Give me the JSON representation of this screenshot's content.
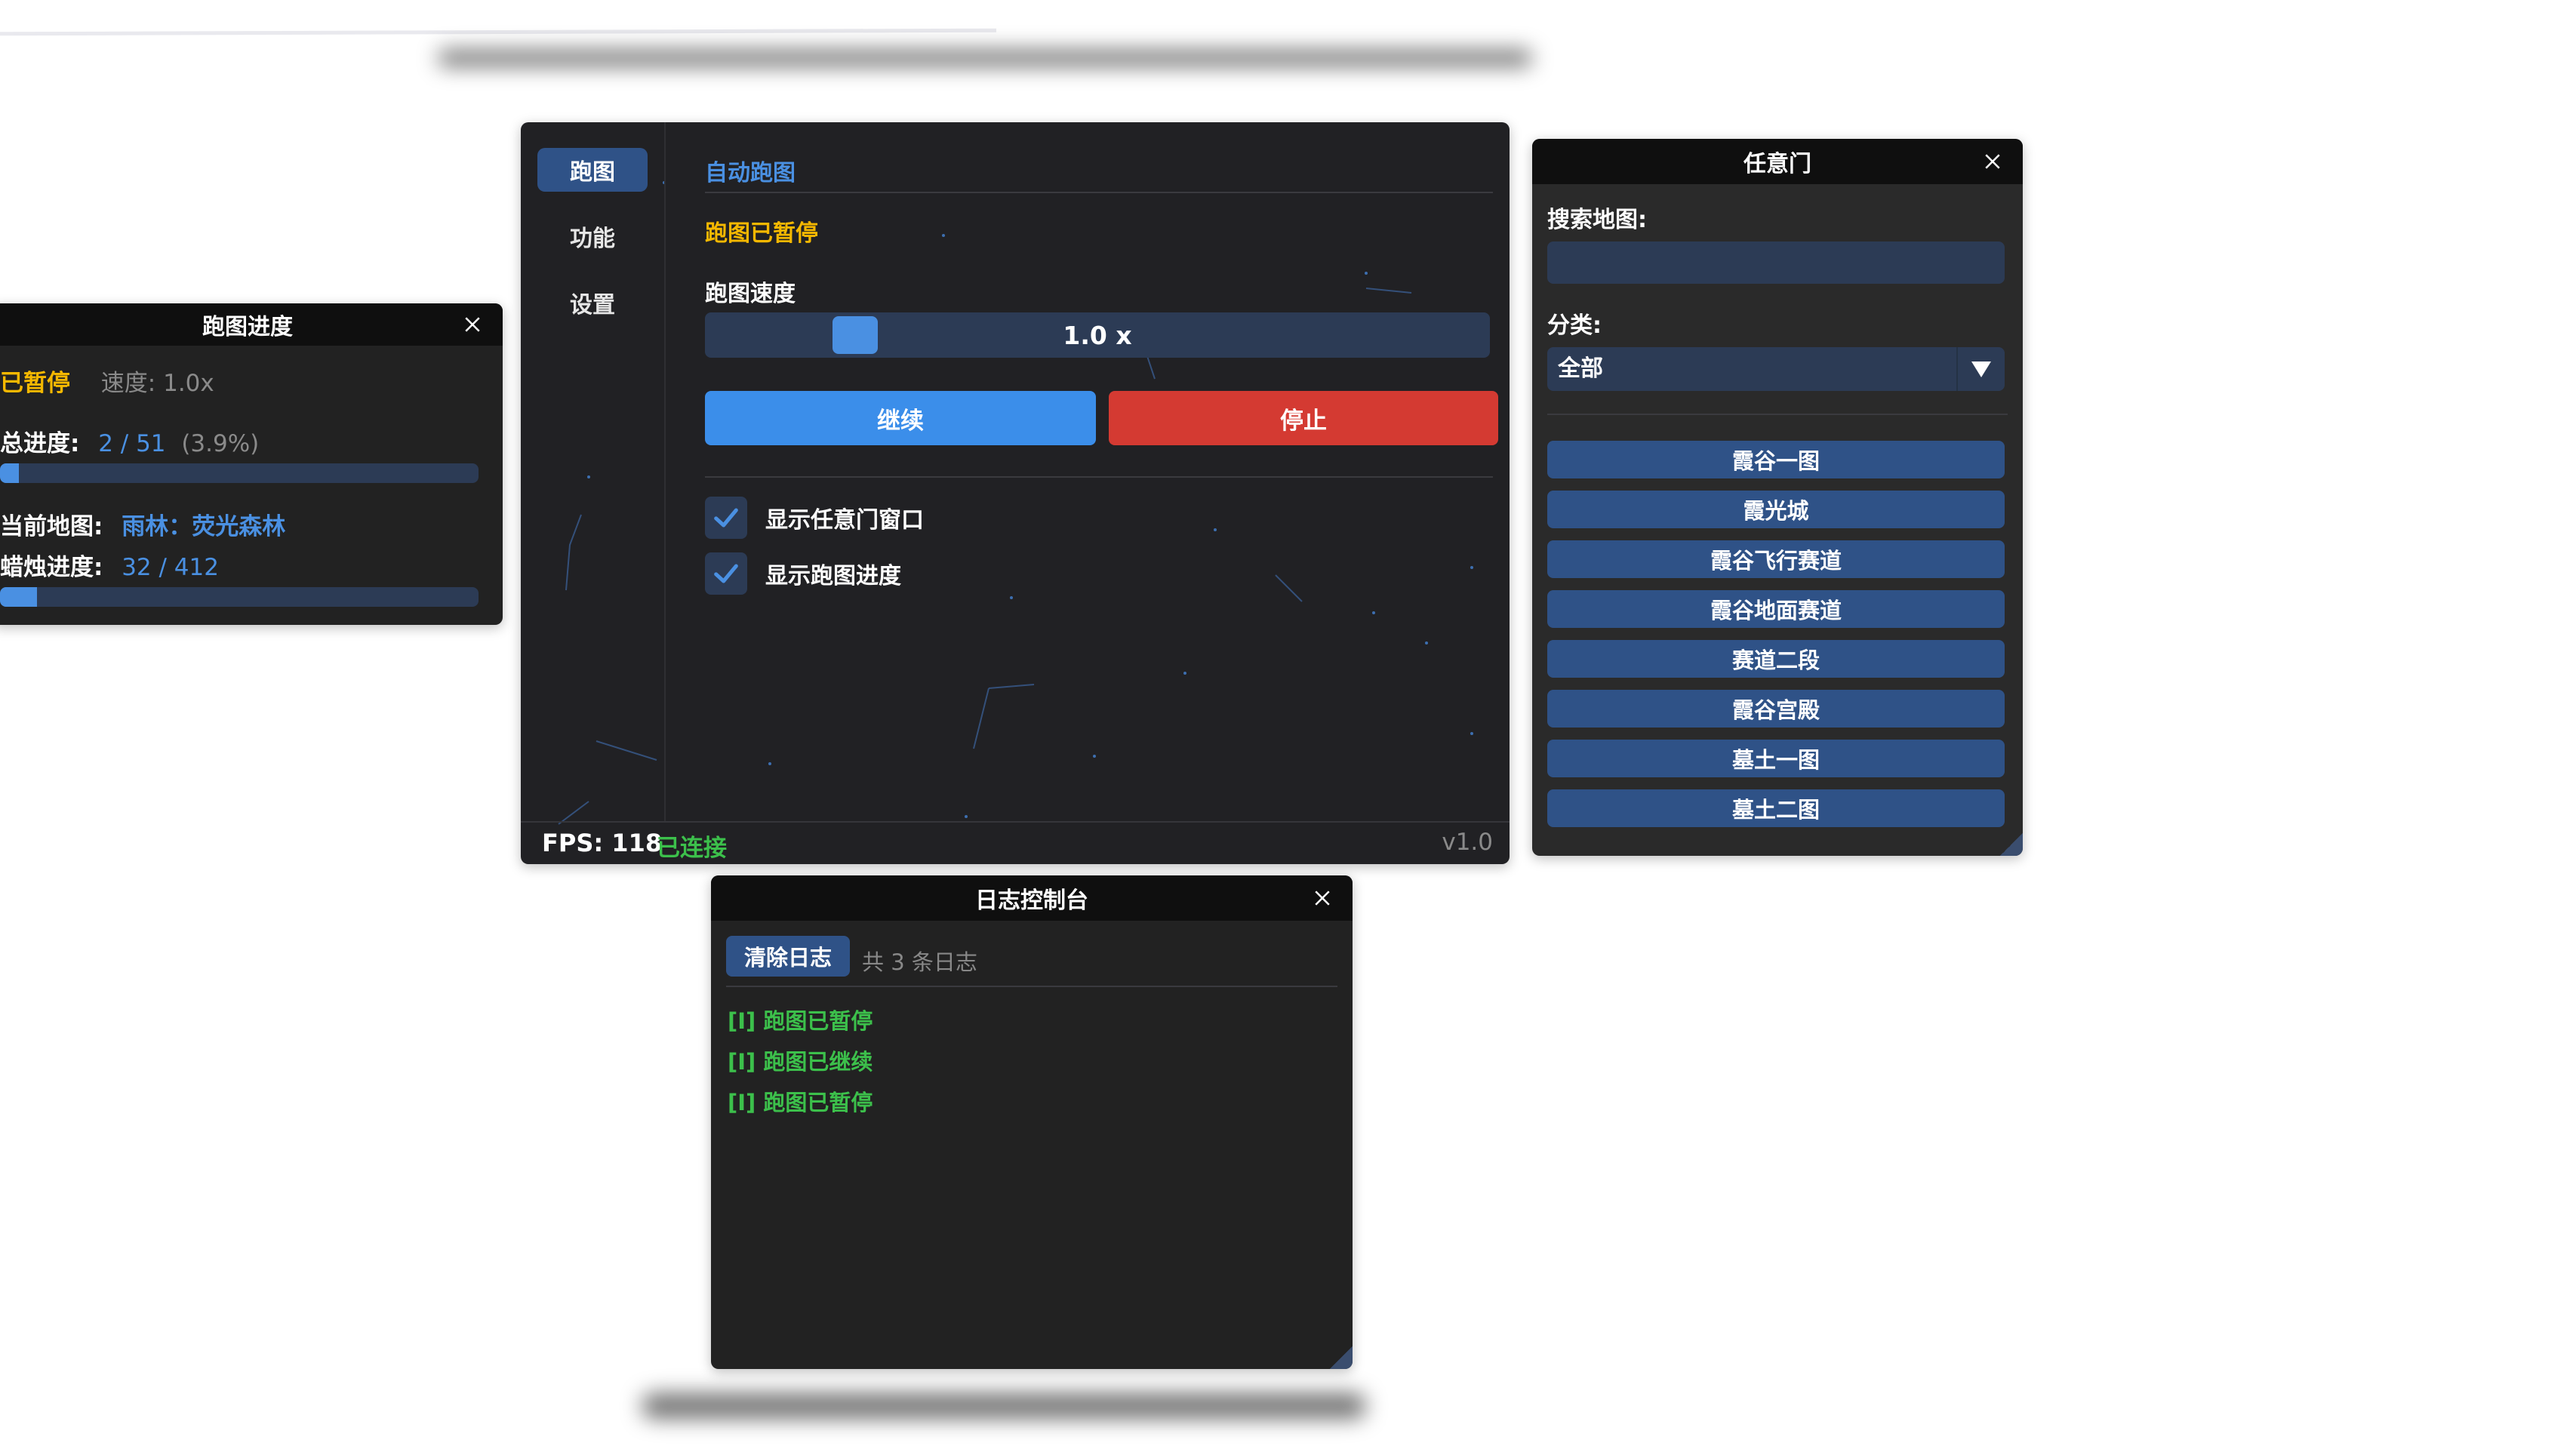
{
  "colors": {
    "accent": "#4a90e2",
    "stop": "#d43a32",
    "paused": "#f5b800",
    "connected": "#3cc04b",
    "panel": "#222222"
  },
  "main": {
    "nav": [
      "跑图",
      "功能",
      "设置"
    ],
    "section_title": "自动跑图",
    "status": "跑图已暂停",
    "speed_label": "跑图速度",
    "speed_value": "1.0 x",
    "speed_fraction": 0.063,
    "continue_label": "继续",
    "stop_label": "停止",
    "checkbox_portal": "显示任意门窗口",
    "checkbox_progress": "显示跑图进度",
    "fps": "FPS: 118",
    "connection": "已连接",
    "version": "v1.0"
  },
  "progress": {
    "title": "跑图进度",
    "state": "已暂停",
    "speed": "速度: 1.0x",
    "total_label": "总进度:",
    "total_value": "2 / 51",
    "total_percent": "(3.9%)",
    "total_fraction": 0.039,
    "map_label": "当前地图:",
    "map_value": "雨林：荧光森林",
    "candle_label": "蜡烛进度:",
    "candle_value": "32 / 412",
    "candle_fraction": 0.078
  },
  "portal": {
    "title": "任意门",
    "search_label": "搜索地图:",
    "search_placeholder": "",
    "category_label": "分类:",
    "category_value": "全部",
    "maps": [
      "霞谷一图",
      "霞光城",
      "霞谷飞行赛道",
      "霞谷地面赛道",
      "赛道二段",
      "霞谷宫殿",
      "墓土一图",
      "墓土二图"
    ]
  },
  "log": {
    "title": "日志控制台",
    "clear_label": "清除日志",
    "count": "共 3 条日志",
    "entries": [
      "[I] 跑图已暂停",
      "[I] 跑图已继续",
      "[I] 跑图已暂停"
    ]
  },
  "icons": {
    "close": "close-icon",
    "check": "check-icon",
    "dropdown": "chevron-down-icon"
  }
}
